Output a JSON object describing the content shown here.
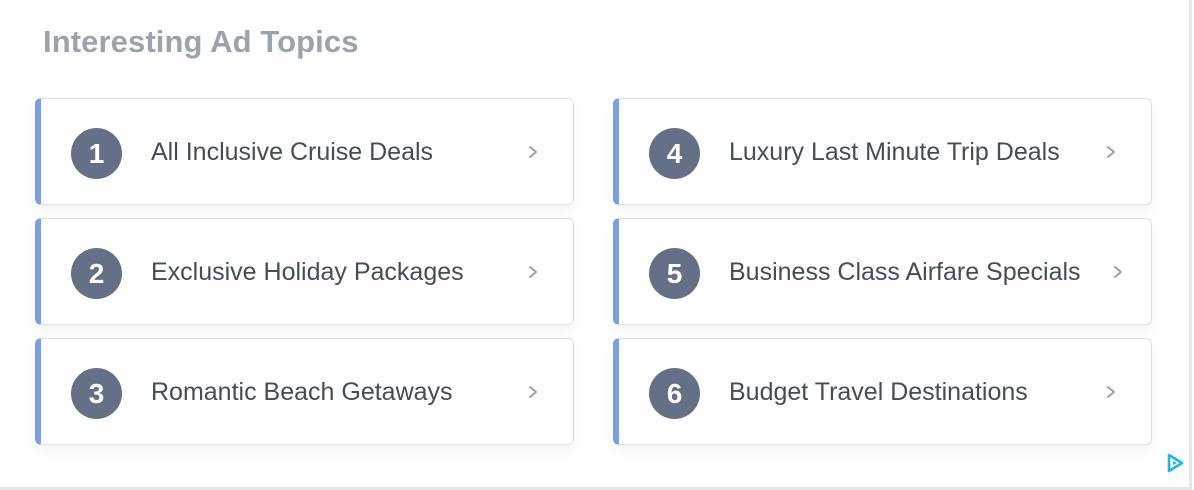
{
  "widget": {
    "title": "Interesting Ad Topics",
    "accent_color": "#7b9fe4",
    "badge_color": "#647085"
  },
  "topics": [
    {
      "number": "1",
      "label": "All Inclusive Cruise Deals",
      "icon": "chevron-right-icon"
    },
    {
      "number": "2",
      "label": "Exclusive Holiday Packages",
      "icon": "chevron-right-icon"
    },
    {
      "number": "3",
      "label": "Romantic Beach Getaways",
      "icon": "chevron-right-icon"
    },
    {
      "number": "4",
      "label": "Luxury Last Minute Trip Deals",
      "icon": "chevron-right-icon"
    },
    {
      "number": "5",
      "label": "Business Class Airfare Specials",
      "icon": "chevron-right-icon"
    },
    {
      "number": "6",
      "label": "Budget Travel Destinations",
      "icon": "chevron-right-icon"
    }
  ],
  "ad_choices": {
    "icon": "adchoices-icon"
  }
}
